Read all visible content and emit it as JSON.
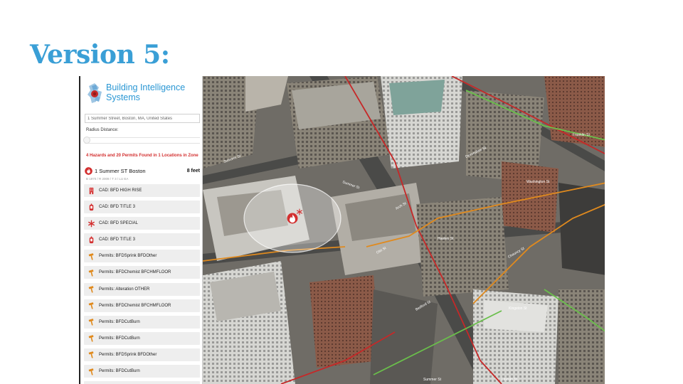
{
  "slide": {
    "title": "Version 5:"
  },
  "app": {
    "name_line1": "Building Intelligence",
    "name_line2": "Systems",
    "address_value": "1 Summer Street, Boston, MA, United States",
    "radius_label": "Radius Distance:",
    "summary": "4 Hazards and 20 Permits Found in 1 Locations in Zone",
    "location": {
      "name": "1 Summer ST Boston",
      "distance": "8 feet",
      "meta": "B 1970 / R 2009 / T 3 / LU EA"
    },
    "items": [
      {
        "label": "CAD: BFD HIGH RISE",
        "icon": "high-rise-icon"
      },
      {
        "label": "CAD: BFD TITLE 3",
        "icon": "extinguisher-icon"
      },
      {
        "label": "CAD: BFD SPECIAL",
        "icon": "asterisk-icon"
      },
      {
        "label": "CAD: BFD TITLE 3",
        "icon": "extinguisher-icon"
      },
      {
        "label": "Permits: BFDSprink BFDOther",
        "icon": "hammer-icon"
      },
      {
        "label": "Permits: BFDChemist BFCHMFLOOR",
        "icon": "hammer-icon"
      },
      {
        "label": "Permits: Alteration OTHER",
        "icon": "hammer-icon"
      },
      {
        "label": "Permits: BFDChemist BFCHMFLOOR",
        "icon": "hammer-icon"
      },
      {
        "label": "Permits: BFDCutBurn",
        "icon": "hammer-icon"
      },
      {
        "label": "Permits: BFDCutBurn",
        "icon": "hammer-icon"
      },
      {
        "label": "Permits: BFDSprink BFDOther",
        "icon": "hammer-icon"
      },
      {
        "label": "Permits: BFDCutBurn",
        "icon": "hammer-icon"
      }
    ]
  },
  "map": {
    "street_labels": [
      "Summer St",
      "Summer St",
      "Washington St",
      "Franklin St",
      "Devonshire St",
      "Arch St",
      "Chauncy St",
      "Hawley St",
      "Otis St",
      "Kingston St",
      "Bedford St",
      "Summer St",
      "Lincoln St"
    ]
  },
  "colors": {
    "brand": "#2a97d4",
    "title": "#3a9fd6",
    "hazard": "#d32f2f"
  }
}
